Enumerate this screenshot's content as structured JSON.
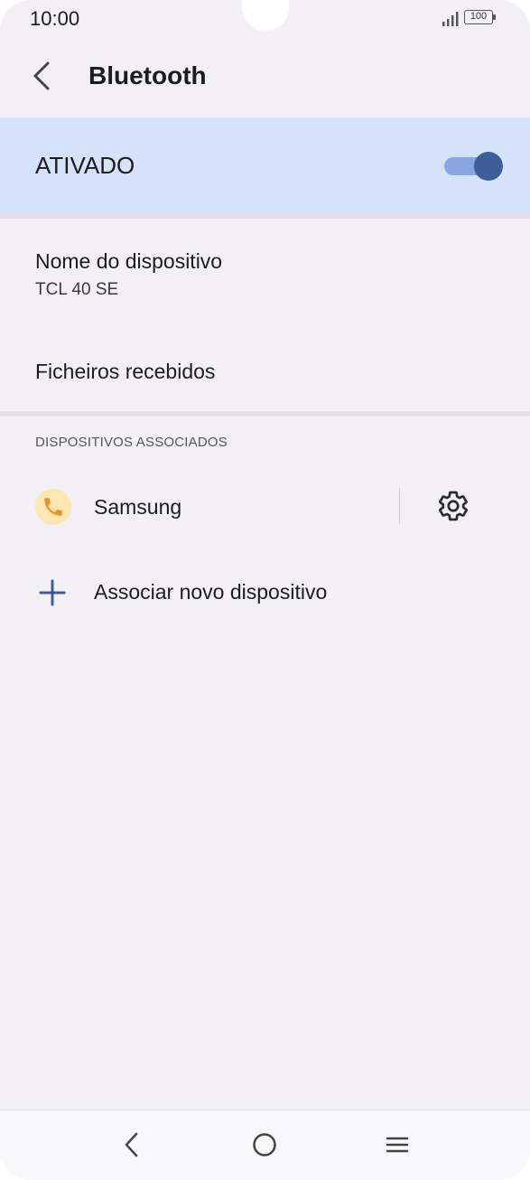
{
  "status_bar": {
    "time": "10:00",
    "battery": "100"
  },
  "app_bar": {
    "title": "Bluetooth"
  },
  "master_toggle": {
    "label": "ATIVADO",
    "on": true,
    "accent_color": "#3d5e97",
    "band_color": "#d5e2fa"
  },
  "settings": {
    "device_name_title": "Nome do dispositivo",
    "device_name_value": "TCL 40 SE",
    "received_files": "Ficheiros recebidos"
  },
  "paired": {
    "section_header": "DISPOSITIVOS ASSOCIADOS",
    "devices": [
      {
        "name": "Samsung",
        "icon": "phone-icon",
        "icon_color": "#e8932d"
      }
    ],
    "pair_new_label": "Associar novo dispositivo",
    "pair_new_icon": "plus-icon"
  },
  "nav_bar": {
    "back_icon": "back-icon",
    "home_icon": "home-icon",
    "menu_icon": "menu-icon"
  }
}
